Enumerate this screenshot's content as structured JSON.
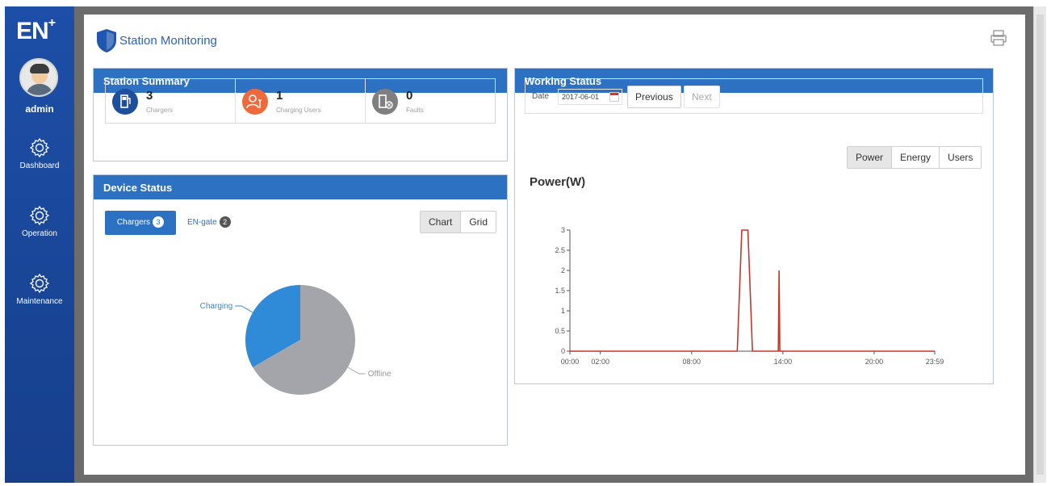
{
  "sidebar": {
    "logo": "EN",
    "logo_sup": "+",
    "user": "admin",
    "items": [
      {
        "label": "Dashboard"
      },
      {
        "label": "Operation"
      },
      {
        "label": "Maintenance"
      }
    ]
  },
  "page": {
    "title": "Station Monitoring"
  },
  "station_summary": {
    "title": "Station Summary",
    "items": [
      {
        "value": "3",
        "label": "Chargers",
        "color": "#1e4f9c"
      },
      {
        "value": "1",
        "label": "Charging Users",
        "color": "#ee6a3c"
      },
      {
        "value": "0",
        "label": "Faults",
        "color": "#7f7f7f"
      }
    ]
  },
  "device_status": {
    "title": "Device Status",
    "tabs": [
      {
        "label": "Chargers",
        "count": "3"
      },
      {
        "label": "EN-gate",
        "count": "2"
      }
    ],
    "view_toggle": [
      "Chart",
      "Grid"
    ],
    "active_view": "Chart"
  },
  "working_status": {
    "title": "Working Status",
    "date_label": "Date",
    "date_value": "2017-06-01",
    "prev_label": "Previous",
    "next_label": "Next",
    "metric_toggle": [
      "Power",
      "Energy",
      "Users"
    ],
    "active_metric": "Power"
  },
  "chart_data": [
    {
      "type": "pie",
      "labels": [
        "Charging",
        "Offline"
      ],
      "values": [
        1,
        2
      ],
      "colors": [
        "#2f8ad8",
        "#a3a5ab"
      ]
    },
    {
      "type": "line",
      "title": "Power(W)",
      "x_ticks": [
        "00:00",
        "02:00",
        "08:00",
        "14:00",
        "20:00",
        "23:59"
      ],
      "x_tick_hours": [
        0,
        2,
        8,
        14,
        20,
        23.983
      ],
      "y_ticks": [
        0,
        0.5,
        1,
        1.5,
        2,
        2.5,
        3
      ],
      "ylim": [
        0,
        3
      ],
      "xlim_hours": [
        0,
        23.983
      ],
      "series": [
        {
          "color": "#c0392b",
          "points_hours": [
            [
              0,
              0
            ],
            [
              11.0,
              0
            ],
            [
              11.3,
              3
            ],
            [
              11.7,
              3
            ],
            [
              12.0,
              0
            ],
            [
              13.7,
              0
            ],
            [
              13.75,
              2
            ],
            [
              13.8,
              0
            ],
            [
              23.983,
              0
            ]
          ]
        }
      ]
    }
  ]
}
